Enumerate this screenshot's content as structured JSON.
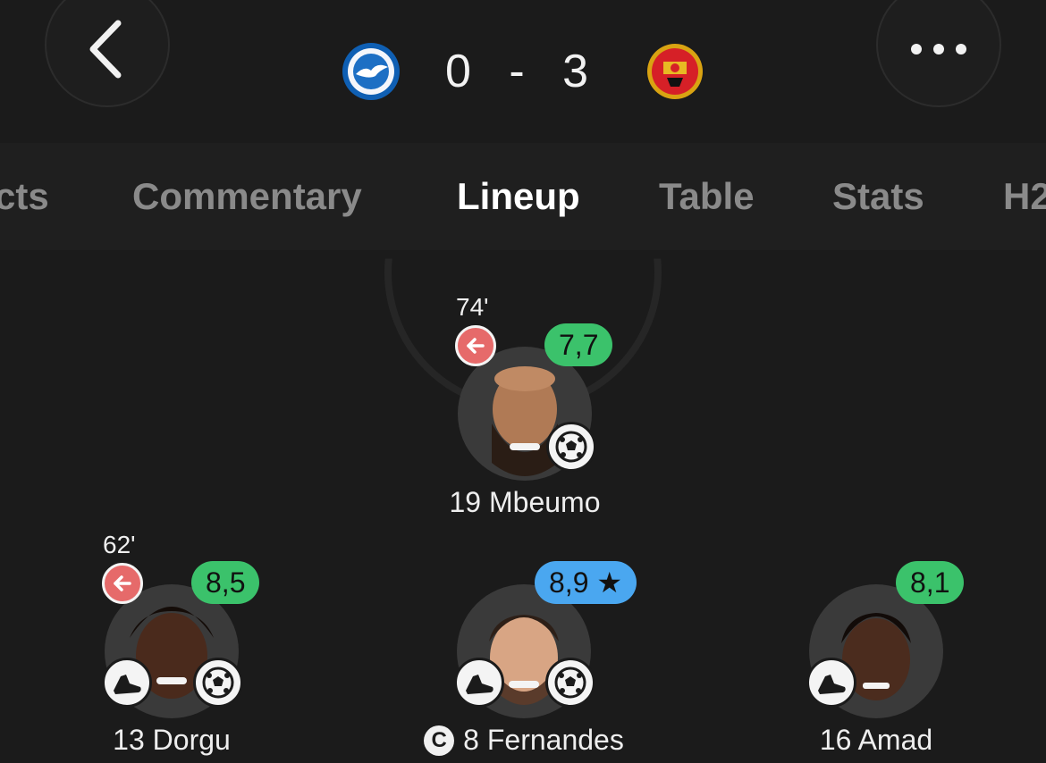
{
  "header": {
    "back_icon": "chevron-left-icon",
    "more_icon": "more-dots-icon",
    "home_crest": "brighton-crest",
    "away_crest": "man-united-crest",
    "score": "0 - 3"
  },
  "tabs": [
    {
      "label": "cts",
      "active": false
    },
    {
      "label": "Commentary",
      "active": false
    },
    {
      "label": "Lineup",
      "active": true
    },
    {
      "label": "Table",
      "active": false
    },
    {
      "label": "Stats",
      "active": false
    },
    {
      "label": "H2",
      "active": false
    }
  ],
  "players": {
    "mbeumo": {
      "name": "19 Mbeumo",
      "minute": "74'",
      "rating": "7,7",
      "sub_icon": "sub-out-icon",
      "badges": [
        "goal-icon"
      ]
    },
    "dorgu": {
      "name": "13 Dorgu",
      "minute": "62'",
      "rating": "8,5",
      "sub_icon": "sub-out-icon",
      "badges": [
        "assist-boot-icon",
        "goal-icon"
      ]
    },
    "fernandes": {
      "name": "8 Fernandes",
      "rating": "8,9 ★",
      "captain": "C",
      "badges": [
        "assist-boot-icon",
        "goal-icon"
      ]
    },
    "amad": {
      "name": "16 Amad",
      "rating": "8,1",
      "badges": [
        "assist-boot-icon"
      ]
    }
  },
  "colors": {
    "background": "#1b1b1b",
    "rating_green": "#3bc26b",
    "rating_blue": "#4aa7f0",
    "sub_red": "#e66a6a"
  }
}
